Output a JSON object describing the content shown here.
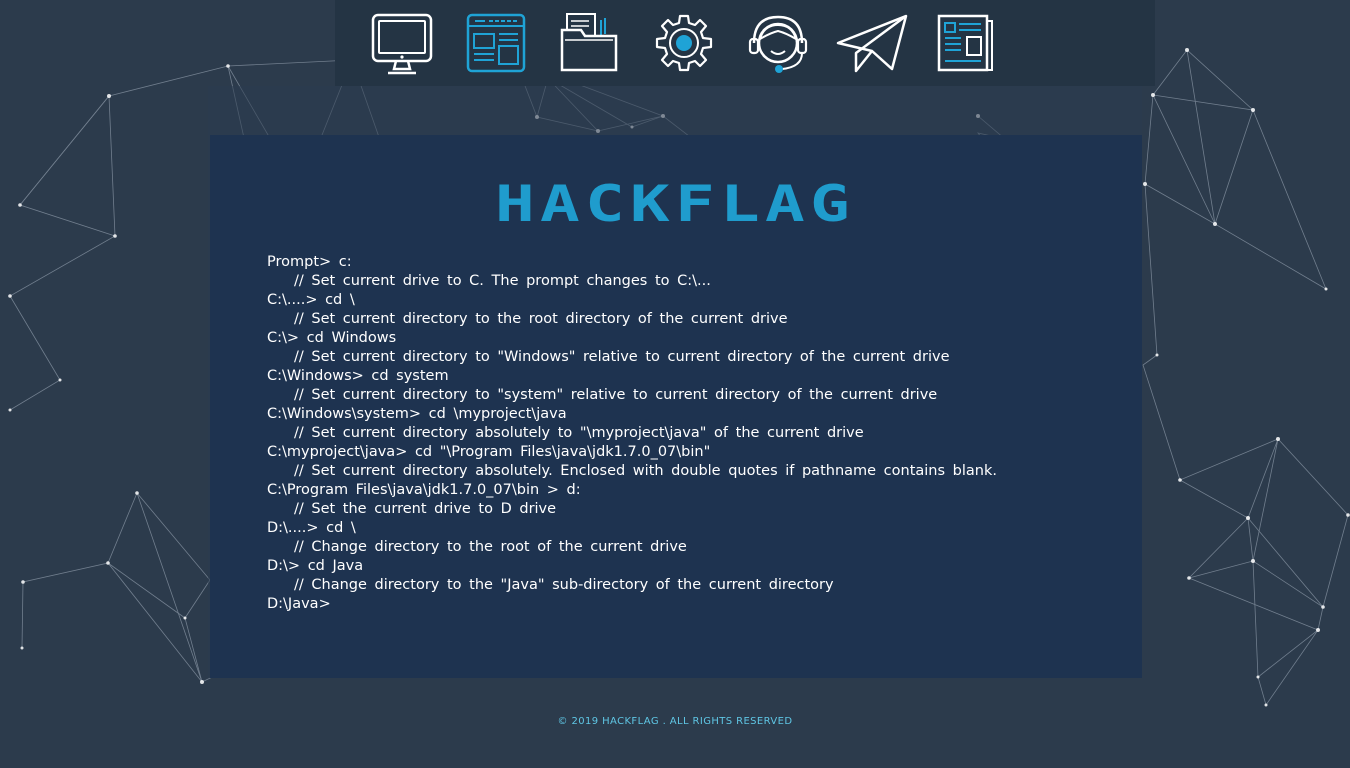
{
  "nav": {
    "items": [
      {
        "icon": "monitor-icon",
        "active": false
      },
      {
        "icon": "web-layout-icon",
        "active": true
      },
      {
        "icon": "folder-icon",
        "active": false
      },
      {
        "icon": "gear-icon",
        "active": false
      },
      {
        "icon": "support-headset-icon",
        "active": false
      },
      {
        "icon": "paper-plane-icon",
        "active": false
      },
      {
        "icon": "newspaper-icon",
        "active": false
      }
    ]
  },
  "brand": {
    "logo_text": "HACKFLAG",
    "accent_color": "#1f9ccd"
  },
  "terminal": {
    "line_0": "Prompt> c:",
    "line_1": "// Set current drive to C. The prompt changes to C:\\...",
    "line_2": "C:\\....> cd \\",
    "line_3": "// Set current directory to the root directory of the current drive",
    "line_4": "C:\\> cd Windows",
    "line_5": "// Set current directory to \"Windows\" relative to current directory of the current drive",
    "line_6": "C:\\Windows> cd system",
    "line_7": "// Set current directory to \"system\" relative to current directory of the current drive",
    "line_8": "C:\\Windows\\system> cd \\myproject\\java",
    "line_9": "// Set current directory absolutely to \"\\myproject\\java\" of the current drive",
    "line_10": "C:\\myproject\\java> cd \"\\Program Files\\java\\jdk1.7.0_07\\bin\"",
    "line_11": "// Set current directory absolutely. Enclosed with double quotes if pathname contains blank.",
    "line_12": "C:\\Program Files\\java\\jdk1.7.0_07\\bin > d:",
    "line_13": "// Set the current drive to D drive",
    "line_14": "D:\\....> cd \\",
    "line_15": "// Change directory to the root of the current drive",
    "line_16": "D:\\> cd Java",
    "line_17": "// Change directory to the \"Java\" sub-directory of the current directory",
    "line_18": "D:\\Java>"
  },
  "footer": {
    "copyright": "© 2019  HACKFLAG . ALL RIGHTS RESERVED"
  }
}
